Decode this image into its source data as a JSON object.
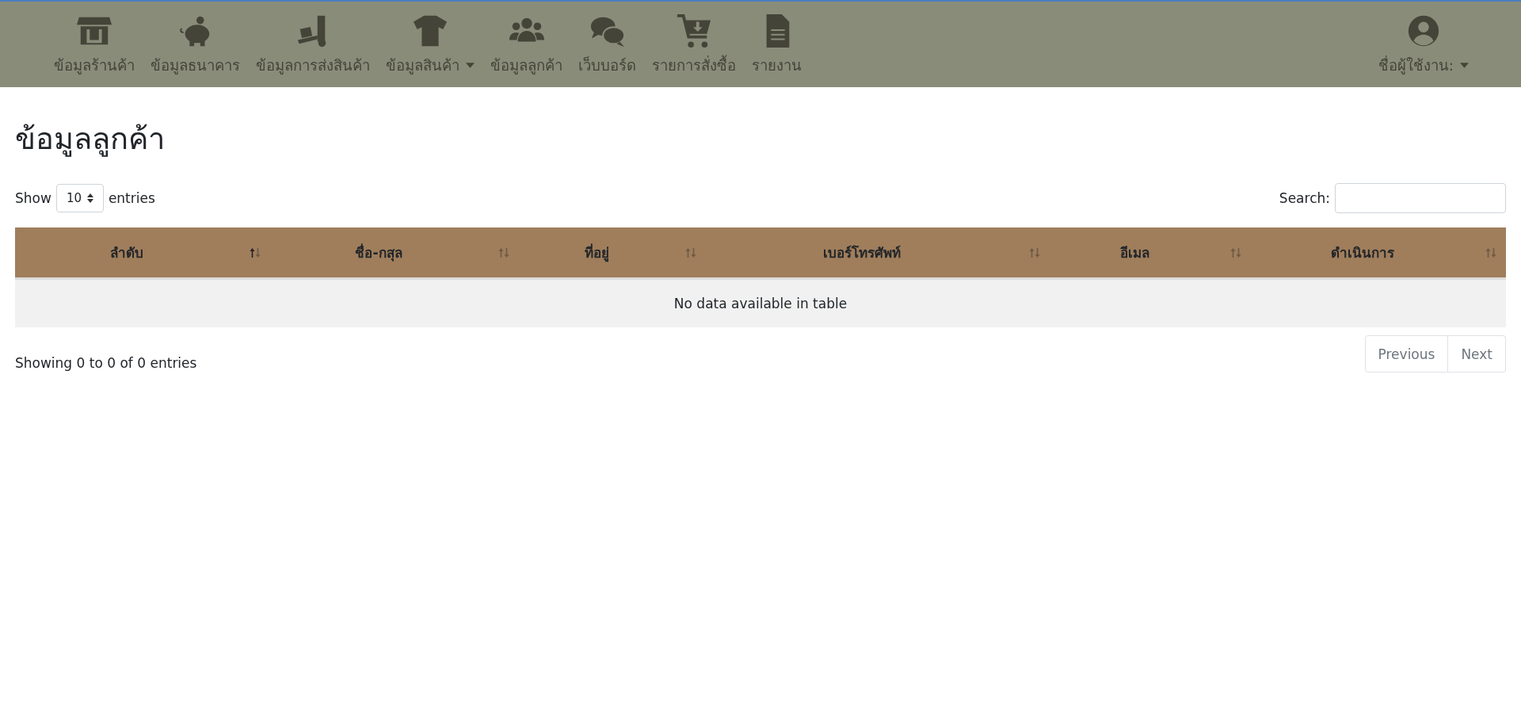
{
  "navbar": {
    "items": [
      {
        "label": "ข้อมูลร้านค้า",
        "dropdown": false,
        "selected": false
      },
      {
        "label": "ข้อมูลธนาคาร",
        "dropdown": false,
        "selected": false
      },
      {
        "label": "ข้อมูลการส่งสินค้า",
        "dropdown": false,
        "selected": false
      },
      {
        "label": "ข้อมูลสินค้า",
        "dropdown": true,
        "selected": false
      },
      {
        "label": "ข้อมูลลูกค้า",
        "dropdown": false,
        "selected": false
      },
      {
        "label": "เว็บบอร์ด",
        "dropdown": false,
        "selected": false
      },
      {
        "label": "รายการสั่งซื้อ",
        "dropdown": false,
        "selected": false
      },
      {
        "label": "รายงาน",
        "dropdown": false,
        "selected": false
      }
    ],
    "user": {
      "label": "ชื่อผู้ใช้งาน:",
      "dropdown": true
    }
  },
  "page_title": "ข้อมูลลูกค้า",
  "length_control": {
    "prefix": "Show",
    "value": "10",
    "suffix": "entries"
  },
  "search": {
    "label": "Search:"
  },
  "table": {
    "columns": [
      {
        "label": "ลำดับ",
        "sorted_ascending": true
      },
      {
        "label": "ชื่อ-กสุล",
        "sorted_ascending": false
      },
      {
        "label": "ที่อยู่",
        "sorted_ascending": false
      },
      {
        "label": "เบอร์โทรศัพท์",
        "sorted_ascending": false
      },
      {
        "label": "อีเมล",
        "sorted_ascending": false
      },
      {
        "label": "ดำเนินการ",
        "sorted_ascending": false
      }
    ],
    "empty_message": "No data available in table"
  },
  "info": "Showing 0 to 0 of 0 entries",
  "pagination": [
    {
      "label": "Previous",
      "disabled": true
    },
    {
      "label": "Next",
      "disabled": true
    }
  ]
}
